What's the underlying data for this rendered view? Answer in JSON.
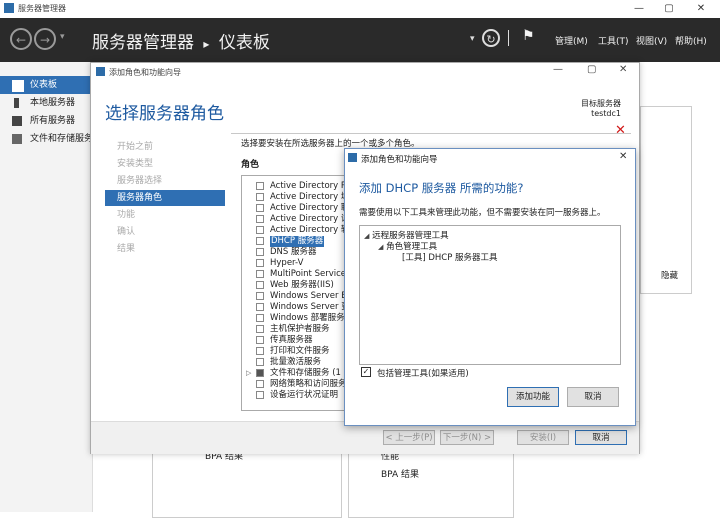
{
  "app": {
    "window_title": "服务器管理器",
    "breadcrumb_app": "服务器管理器",
    "breadcrumb_sep": "▸",
    "breadcrumb_page": "仪表板",
    "menu": [
      "管理(M)",
      "工具(T)",
      "视图(V)",
      "帮助(H)"
    ]
  },
  "sidebar": {
    "items": [
      {
        "label": "仪表板",
        "icon": "dashboard-icon"
      },
      {
        "label": "本地服务器",
        "icon": "server-icon"
      },
      {
        "label": "所有服务器",
        "icon": "servers-icon"
      },
      {
        "label": "文件和存储服务",
        "icon": "storage-icon"
      }
    ]
  },
  "background": {
    "hide_label": "隐藏",
    "bpa_left": "BPA 结果",
    "perf": "性能",
    "bpa_right": "BPA 结果"
  },
  "wizard": {
    "title": "添加角色和功能向导",
    "heading": "选择服务器角色",
    "target_label": "目标服务器",
    "target_value": "testdc1",
    "steps": [
      "开始之前",
      "安装类型",
      "服务器选择",
      "服务器角色",
      "功能",
      "确认",
      "结果"
    ],
    "active_step": 3,
    "description": "选择要安装在所选服务器上的一个或多个角色。",
    "roles_label": "角色",
    "roles": [
      "Active Directory R",
      "Active Directory 域",
      "Active Directory 联",
      "Active Directory 证",
      "Active Directory 轻",
      "DHCP 服务器",
      "DNS 服务器",
      "Hyper-V",
      "MultiPoint Service",
      "Web 服务器(IIS)",
      "Windows Server E",
      "Windows Server 更",
      "Windows 部署服务",
      "主机保护者服务",
      "传真服务器",
      "打印和文件服务",
      "批量激活服务",
      "文件和存储服务 (1",
      "网络策略和访问服务",
      "设备运行状况证明"
    ],
    "highlighted_role": "DHCP 服务器",
    "buttons": {
      "prev": "< 上一步(P)",
      "next": "下一步(N) >",
      "install": "安装(I)",
      "cancel": "取消"
    }
  },
  "dialog": {
    "title": "添加角色和功能向导",
    "question": "添加 DHCP 服务器 所需的功能?",
    "description": "需要使用以下工具来管理此功能，但不需要安装在同一服务器上。",
    "tree": [
      {
        "label": "远程服务器管理工具",
        "level": 0
      },
      {
        "label": "角色管理工具",
        "level": 1
      },
      {
        "label": "[工具] DHCP 服务器工具",
        "level": 2
      }
    ],
    "include_tools_label": "包括管理工具(如果适用)",
    "include_tools_checked": true,
    "add_button": "添加功能",
    "cancel_button": "取消"
  },
  "colors": {
    "accent": "#2f6fb3",
    "heading": "#1e5aa0",
    "header_bg": "#2a2a2a",
    "error_x": "#d11a1a"
  }
}
